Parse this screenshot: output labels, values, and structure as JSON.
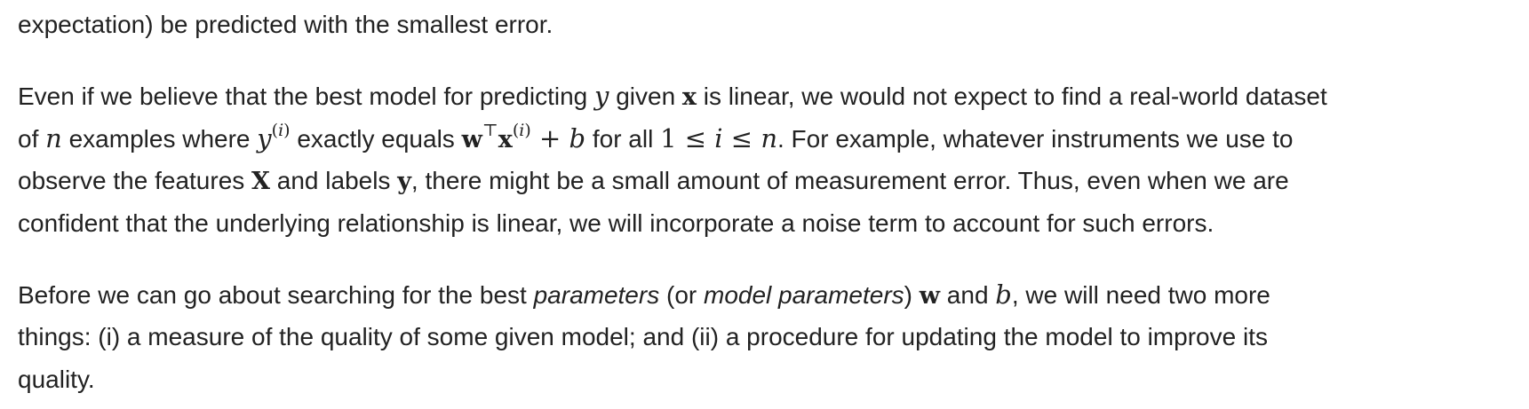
{
  "para1": {
    "text": "expectation) be predicted with the smallest error."
  },
  "para2": {
    "l1_a": "Even if we believe that the best model for predicting ",
    "l1_y": "y",
    "l1_b": " given ",
    "l1_x": "x",
    "l1_c": " is linear, we would not expect to find a real-world dataset",
    "l2_a": "of ",
    "l2_n": "n",
    "l2_b": " examples where ",
    "l2_y": "y",
    "l2_sup_l": "(",
    "l2_sup_i": "i",
    "l2_sup_r": ")",
    "l2_c": " exactly equals ",
    "l2_w": "w",
    "l2_T": "⊤",
    "l2_x": "x",
    "l2_sup2_l": "(",
    "l2_sup2_i": "i",
    "l2_sup2_r": ")",
    "l2_plus": " + ",
    "l2_b2": "b",
    "l2_d": " for all ",
    "l2_one": "1 ≤ ",
    "l2_i": "i",
    "l2_le": " ≤ ",
    "l2_n2": "n",
    "l2_e": ". For example, whatever instruments we use to",
    "l3_a": "observe the features ",
    "l3_X": "X",
    "l3_b": " and labels ",
    "l3_y": "y",
    "l3_c": ", there might be a small amount of measurement error. Thus, even when we are",
    "l4": "confident that the underlying relationship is linear, we will incorporate a noise term to account for such errors."
  },
  "para3": {
    "l1_a": "Before we can go about searching for the best ",
    "l1_em1": "parameters",
    "l1_b": " (or ",
    "l1_em2": "model parameters",
    "l1_c": ") ",
    "l1_w": "w",
    "l1_d": " and ",
    "l1_bvar": "b",
    "l1_e": ", we will need two more",
    "l2": "things: (i) a measure of the quality of some given model; and (ii) a procedure for updating the model to improve its",
    "l3": "quality."
  }
}
